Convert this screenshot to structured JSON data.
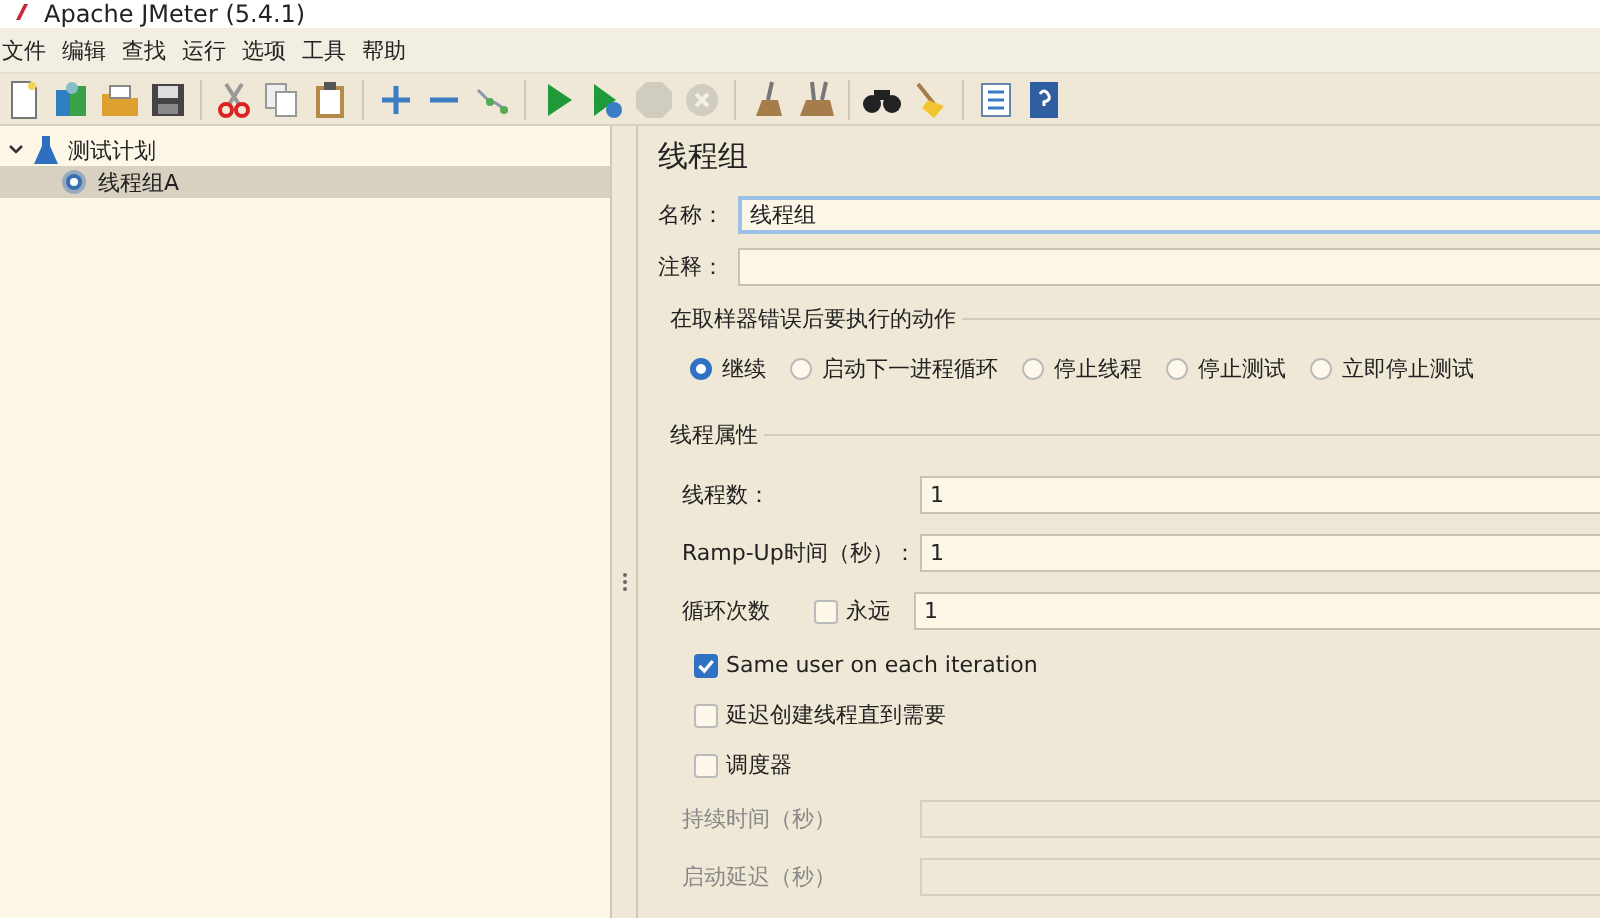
{
  "window": {
    "title": "Apache JMeter (5.4.1)"
  },
  "menu": [
    "文件",
    "编辑",
    "查找",
    "运行",
    "选项",
    "工具",
    "帮助"
  ],
  "toolbar": [
    {
      "kind": "new",
      "disabled": false
    },
    {
      "kind": "templates",
      "disabled": false
    },
    {
      "kind": "open",
      "disabled": false
    },
    {
      "kind": "save",
      "disabled": false
    },
    {
      "kind": "separator"
    },
    {
      "kind": "cut",
      "disabled": false
    },
    {
      "kind": "copy",
      "disabled": false
    },
    {
      "kind": "paste",
      "disabled": false
    },
    {
      "kind": "separator"
    },
    {
      "kind": "expand",
      "disabled": false
    },
    {
      "kind": "collapse",
      "disabled": false
    },
    {
      "kind": "toggle",
      "disabled": false
    },
    {
      "kind": "separator"
    },
    {
      "kind": "start",
      "disabled": false
    },
    {
      "kind": "start-no-pause",
      "disabled": false
    },
    {
      "kind": "stop",
      "disabled": true
    },
    {
      "kind": "shutdown",
      "disabled": true
    },
    {
      "kind": "separator"
    },
    {
      "kind": "clear",
      "disabled": false
    },
    {
      "kind": "clear-all",
      "disabled": false
    },
    {
      "kind": "separator"
    },
    {
      "kind": "search",
      "disabled": false
    },
    {
      "kind": "reset-search",
      "disabled": false
    },
    {
      "kind": "separator"
    },
    {
      "kind": "function-list",
      "disabled": false
    },
    {
      "kind": "help",
      "disabled": false
    }
  ],
  "tree": [
    {
      "label": "测试计划",
      "kind": "test-plan",
      "expanded": true,
      "selected": false,
      "children": [
        {
          "label": "线程组A",
          "kind": "thread-group",
          "selected": true
        }
      ]
    }
  ],
  "panel": {
    "title": "线程组",
    "name_label": "名称：",
    "name_value": "线程组",
    "comment_label": "注释：",
    "error_action": {
      "title": "在取样器错误后要执行的动作",
      "options": [
        {
          "label": "继续",
          "selected": true
        },
        {
          "label": "启动下一进程循环",
          "selected": false
        },
        {
          "label": "停止线程",
          "selected": false
        },
        {
          "label": "停止测试",
          "selected": false
        },
        {
          "label": "立即停止测试",
          "selected": false
        }
      ]
    },
    "thread_props": {
      "title": "线程属性",
      "fields": [
        {
          "label": "线程数：",
          "value": "1",
          "disabled": false
        },
        {
          "label": "Ramp-Up时间（秒）：",
          "value": "1",
          "disabled": false
        }
      ],
      "loop": {
        "label": "循环次数",
        "forever_label": "永远",
        "forever_checked": false,
        "value": "1"
      },
      "checks": [
        {
          "label": "Same user on each iteration",
          "checked": true
        },
        {
          "label": "延迟创建线程直到需要",
          "checked": false
        },
        {
          "label": "调度器",
          "checked": false
        }
      ],
      "sched_fields": [
        {
          "label": "持续时间（秒）",
          "disabled": true
        },
        {
          "label": "启动延迟（秒）",
          "disabled": true
        }
      ]
    }
  }
}
